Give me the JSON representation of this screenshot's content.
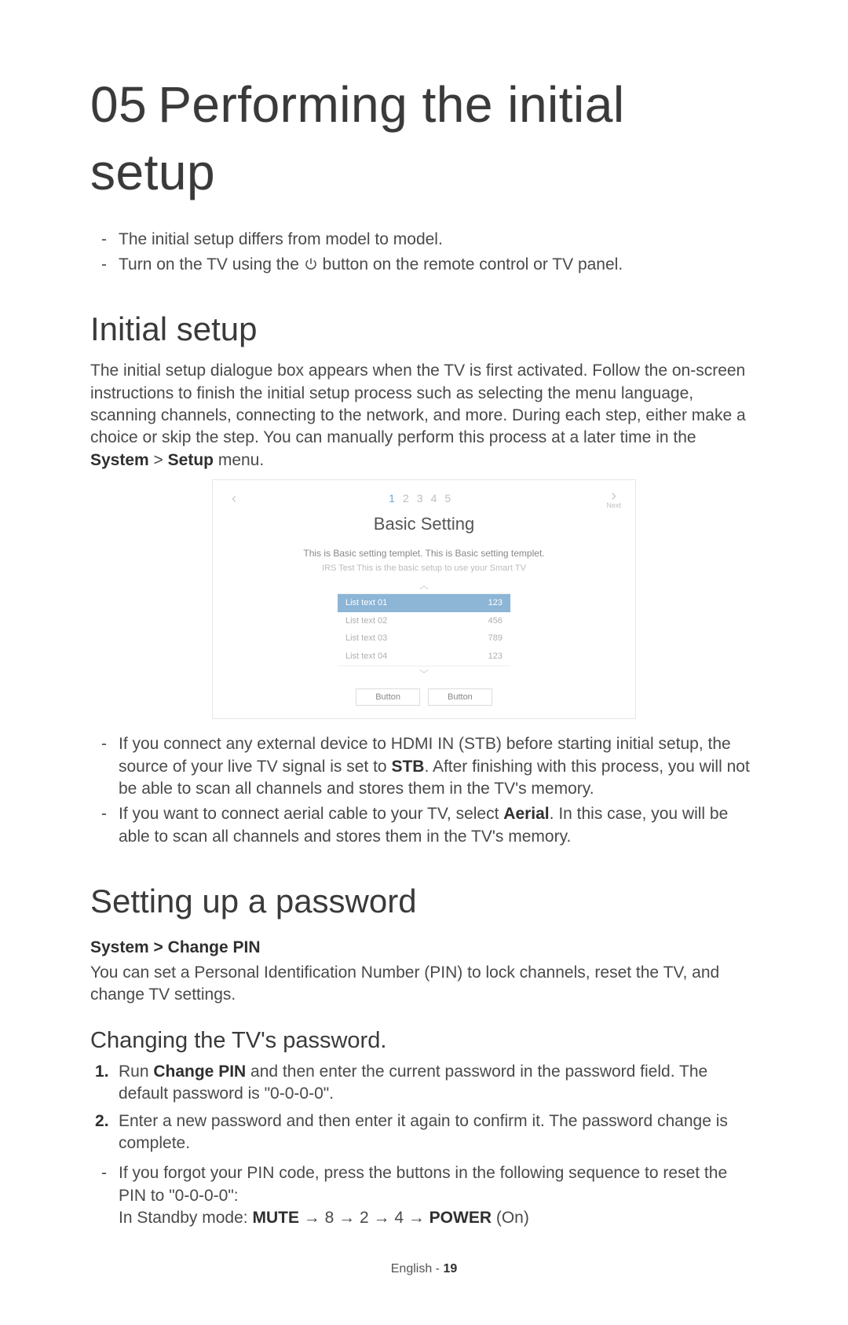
{
  "chapter": {
    "number": "05",
    "title": "Performing the initial setup"
  },
  "intro_bullets": [
    {
      "text": "The initial setup differs from model to model."
    },
    {
      "pre": "Turn on the TV using the ",
      "post": " button on the remote control or TV panel."
    }
  ],
  "section1": {
    "heading": "Initial setup",
    "para": {
      "t1": "The initial setup dialogue box appears when the TV is first activated. Follow the on-screen instructions to finish the initial setup process such as selecting the menu language, scanning channels, connecting to the network, and more. During each step, either make a choice or skip the step. You can manually perform this process at a later time in the ",
      "bold1": "System",
      "arrow": " > ",
      "bold2": "Setup",
      "t2": " menu."
    },
    "notes": [
      {
        "pre": "If you connect any external device to HDMI IN (STB) before starting initial setup, the source of your live TV signal is set to ",
        "bold": "STB",
        "post": ". After finishing with this process, you will not be able to scan all channels and stores them in the TV's memory."
      },
      {
        "pre": "If you want to connect aerial cable to your TV, select ",
        "bold": "Aerial",
        "post": ". In this case, you will be able to scan all channels and stores them in the TV's memory."
      }
    ]
  },
  "dialog": {
    "left_arrow": "‹",
    "right_arrow": "›",
    "next_label": "Next",
    "steps": [
      "1",
      "2",
      "3",
      "4",
      "5"
    ],
    "current_step_index": 0,
    "title": "Basic Setting",
    "subtitle1": "This is Basic setting templet. This is Basic setting templet.",
    "subtitle2": "IRS Test This is the basic setup to use your Smart TV",
    "chev_up": "︿",
    "chev_down": "﹀",
    "rows": [
      {
        "label": "List text 01",
        "value": "123",
        "selected": true
      },
      {
        "label": "List text 02",
        "value": "456",
        "selected": false
      },
      {
        "label": "List text 03",
        "value": "789",
        "selected": false
      },
      {
        "label": "List text 04",
        "value": "123",
        "selected": false
      }
    ],
    "button_label": "Button"
  },
  "section2": {
    "heading": "Setting up a password",
    "crumb": {
      "a": "System",
      "sep": " > ",
      "b": "Change PIN"
    },
    "para": "You can set a Personal Identification Number (PIN) to lock channels, reset the TV, and change TV settings.",
    "sub_heading": "Changing the TV's password.",
    "steps": [
      {
        "pre": "Run ",
        "bold": "Change PIN",
        "post": " and then enter the current password in the password field. The default password is \"0-0-0-0\"."
      },
      {
        "text": "Enter a new password and then enter it again to confirm it. The password change is complete."
      }
    ],
    "note": {
      "line1": "If you forgot your PIN code, press the buttons in the following sequence to reset the PIN to \"0-0-0-0\":",
      "line2_pre": "In Standby mode: ",
      "seq": [
        {
          "bold": true,
          "t": "MUTE"
        },
        {
          "bold": false,
          "t": " → 8 → 2 → 4 → "
        },
        {
          "bold": true,
          "t": "POWER"
        },
        {
          "bold": false,
          "t": " (On)"
        }
      ]
    }
  },
  "footer": {
    "lang": "English",
    "sep": " - ",
    "page": "19"
  }
}
